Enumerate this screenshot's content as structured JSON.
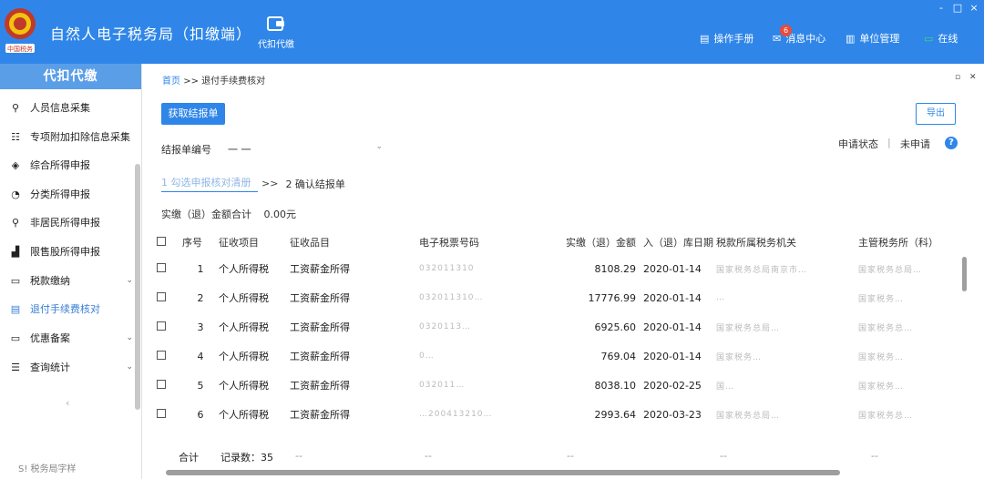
{
  "header": {
    "app_title": "自然人电子税务局（扣缴端）",
    "logo_text": "中国税务",
    "nav_item": "代扣代缴",
    "toolbar": {
      "manual": "操作手册",
      "messages": "消息中心",
      "message_count": "6",
      "unit_mgmt": "单位管理",
      "online": "在线"
    },
    "window_controls": [
      "-",
      "□",
      "×"
    ]
  },
  "sidebar": {
    "title": "代扣代缴",
    "items": [
      {
        "label": "人员信息采集",
        "icon": "person-icon"
      },
      {
        "label": "专项附加扣除信息采集",
        "icon": "list-icon"
      },
      {
        "label": "综合所得申报",
        "icon": "layers-icon"
      },
      {
        "label": "分类所得申报",
        "icon": "pie-icon"
      },
      {
        "label": "非居民所得申报",
        "icon": "person-icon"
      },
      {
        "label": "限售股所得申报",
        "icon": "bar-chart-icon"
      },
      {
        "label": "税款缴纳",
        "icon": "folder-icon"
      },
      {
        "label": "退付手续费核对",
        "icon": "document-icon"
      },
      {
        "label": "优惠备案",
        "icon": "folder-icon"
      },
      {
        "label": "查询统计",
        "icon": "search-list-icon"
      }
    ],
    "collapse": "‹",
    "footer": "S! 税务局字样"
  },
  "main": {
    "breadcrumb": {
      "home": "首页",
      "sep": ">>",
      "current": "退付手续费核对"
    },
    "get_report_button": "获取结报单",
    "export_button": "导出",
    "report_no_label": "结报单编号",
    "report_no_value": "一 一",
    "apply_status_label": "申请状态",
    "apply_status_value": "未申请",
    "help": "?",
    "steps": {
      "step1": "1 勾选申报核对清册",
      "sep": ">>",
      "step2": "2 确认结报单"
    },
    "total_label": "实缴（退）金额合计",
    "total_value": "0.00元",
    "table": {
      "headers": [
        "序号",
        "征收项目",
        "征收品目",
        "电子税票号码",
        "实缴（退）金额",
        "入（退）库日期",
        "税款所属税务机关",
        "主管税务所（科）"
      ],
      "rows": [
        {
          "no": "1",
          "item": "个人所得税",
          "sub": "工资薪金所得",
          "ticket": "032011310",
          "amount": "8108.29",
          "date": "2020-01-14",
          "org": "国家税务总局南京市…",
          "office": "国家税务总局…"
        },
        {
          "no": "2",
          "item": "个人所得税",
          "sub": "工资薪金所得",
          "ticket": "032011310…",
          "amount": "17776.99",
          "date": "2020-01-14",
          "org": "…",
          "office": "国家税务…"
        },
        {
          "no": "3",
          "item": "个人所得税",
          "sub": "工资薪金所得",
          "ticket": "0320113…",
          "amount": "6925.60",
          "date": "2020-01-14",
          "org": "国家税务总局…",
          "office": "国家税务总…"
        },
        {
          "no": "4",
          "item": "个人所得税",
          "sub": "工资薪金所得",
          "ticket": "0…",
          "amount": "769.04",
          "date": "2020-01-14",
          "org": "国家税务…",
          "office": "国家税务…"
        },
        {
          "no": "5",
          "item": "个人所得税",
          "sub": "工资薪金所得",
          "ticket": "032011…",
          "amount": "8038.10",
          "date": "2020-02-25",
          "org": "国…",
          "office": "国家税务…"
        },
        {
          "no": "6",
          "item": "个人所得税",
          "sub": "工资薪金所得",
          "ticket": "…200413210…",
          "amount": "2993.64",
          "date": "2020-03-23",
          "org": "国家税务总局…",
          "office": "国家税务总…"
        }
      ]
    },
    "summary": {
      "label": "合计",
      "count_label": "记录数：35",
      "dash": "--"
    }
  }
}
